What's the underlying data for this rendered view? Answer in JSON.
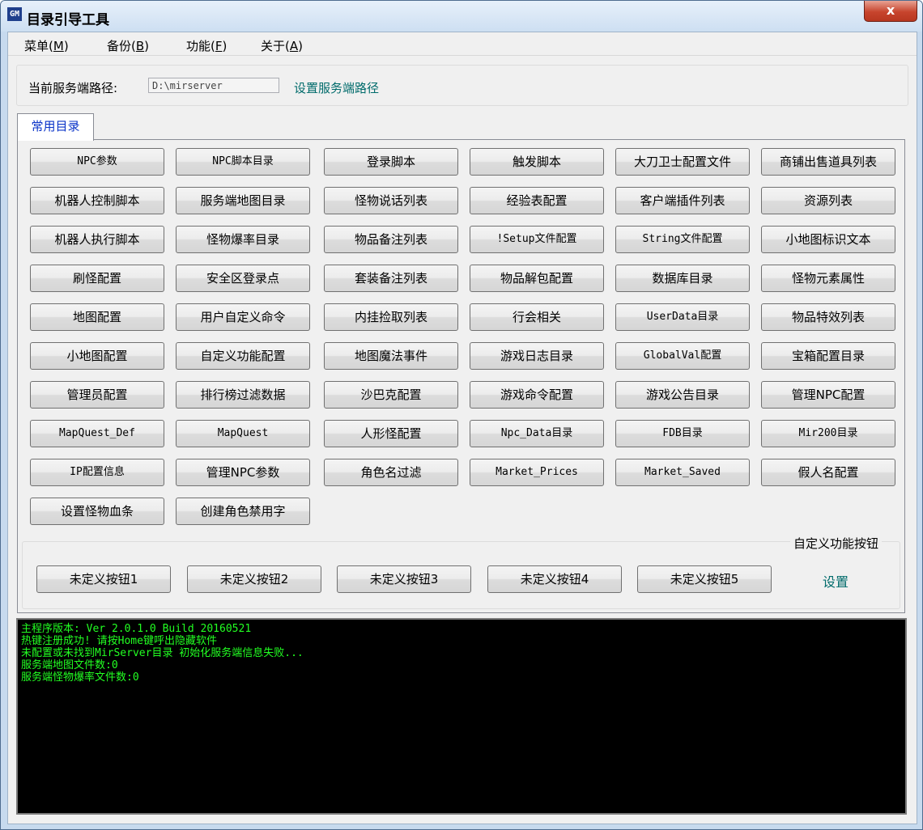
{
  "window": {
    "icon_text": "GM",
    "title": "目录引导工具",
    "close_glyph": "x"
  },
  "menu": [
    {
      "label": "菜单(",
      "hot": "M",
      "end": ")"
    },
    {
      "label": "备份(",
      "hot": "B",
      "end": ")"
    },
    {
      "label": "功能(",
      "hot": "F",
      "end": ")"
    },
    {
      "label": "关于(",
      "hot": "A",
      "end": ")"
    }
  ],
  "server_path": {
    "label": "当前服务端路径:",
    "value": "D:\\mirserver",
    "set_link": "设置服务端路径"
  },
  "tab": {
    "label": "常用目录"
  },
  "buttons": [
    [
      "NPC参数",
      "NPC脚本目录",
      "登录脚本",
      "触发脚本",
      "大刀卫士配置文件",
      "商铺出售道具列表"
    ],
    [
      "机器人控制脚本",
      "服务端地图目录",
      "怪物说话列表",
      "经验表配置",
      "客户端插件列表",
      "资源列表"
    ],
    [
      "机器人执行脚本",
      "怪物爆率目录",
      "物品备注列表",
      "!Setup文件配置",
      "String文件配置",
      "小地图标识文本"
    ],
    [
      "刷怪配置",
      "安全区登录点",
      "套装备注列表",
      "物品解包配置",
      "数据库目录",
      "怪物元素属性"
    ],
    [
      "地图配置",
      "用户自定义命令",
      "内挂捡取列表",
      "行会相关",
      "UserData目录",
      "物品特效列表"
    ],
    [
      "小地图配置",
      "自定义功能配置",
      "地图魔法事件",
      "游戏日志目录",
      "GlobalVal配置",
      "宝箱配置目录"
    ],
    [
      "管理员配置",
      "排行榜过滤数据",
      "沙巴克配置",
      "游戏命令配置",
      "游戏公告目录",
      "管理NPC配置"
    ],
    [
      "MapQuest_Def",
      "MapQuest",
      "人形怪配置",
      "Npc_Data目录",
      "FDB目录",
      "Mir200目录"
    ],
    [
      "IP配置信息",
      "管理NPC参数",
      "角色名过滤",
      "Market_Prices",
      "Market_Saved",
      "假人名配置"
    ],
    [
      "设置怪物血条",
      "创建角色禁用字"
    ]
  ],
  "custom_group": {
    "label": "自定义功能按钮",
    "buttons": [
      "未定义按钮1",
      "未定义按钮2",
      "未定义按钮3",
      "未定义按钮4",
      "未定义按钮5"
    ],
    "settings_link": "设置"
  },
  "console": {
    "text_color": "#22ff22",
    "lines": [
      "主程序版本: Ver 2.0.1.0 Build 20160521",
      "热键注册成功! 请按Home键呼出隐藏软件",
      "未配置或未找到MirServer目录 初始化服务端信息失败...",
      "服务端地图文件数:0",
      "服务端怪物爆率文件数:0"
    ]
  }
}
